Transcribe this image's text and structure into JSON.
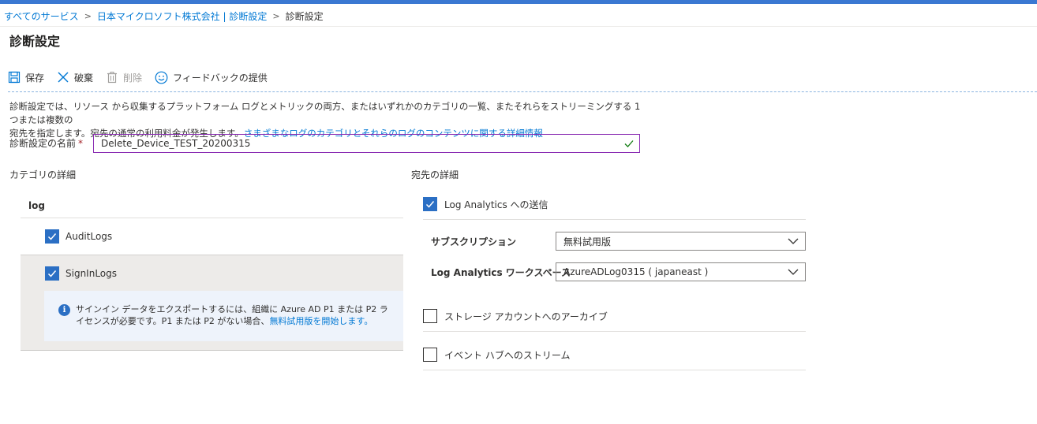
{
  "breadcrumb": {
    "items": [
      "すべてのサービス",
      "日本マイクロソフト株式会社 | 診断設定",
      "診断設定"
    ]
  },
  "page_title": "診断設定",
  "toolbar": {
    "save": "保存",
    "discard": "破棄",
    "delete": "削除",
    "feedback": "フィードバックの提供"
  },
  "description": {
    "line1": "診断設定では、リソース から収集するプラットフォーム ログとメトリックの両方、またはいずれかのカテゴリの一覧、またそれらをストリーミングする 1 つまたは複数の",
    "line2": "宛先を指定します。宛先の通常の利用料金が発生します。",
    "link": "さまざまなログのカテゴリとそれらのログのコンテンツに関する詳細情報"
  },
  "name_field": {
    "label": "診断設定の名前",
    "required_mark": "*",
    "value": "Delete_Device_TEST_20200315"
  },
  "categories": {
    "title": "カテゴリの詳細",
    "group": "log",
    "items": [
      {
        "label": "AuditLogs",
        "checked": true
      },
      {
        "label": "SignInLogs",
        "checked": true
      }
    ],
    "info": {
      "text": "サインイン データをエクスポートするには、組織に Azure AD P1 または P2 ライセンスが必要です。P1 または P2 がない場合、",
      "link": "無料試用版を開始します。"
    }
  },
  "destinations": {
    "title": "宛先の詳細",
    "log_analytics": {
      "label": "Log Analytics への送信",
      "checked": true
    },
    "subscription": {
      "label": "サブスクリプション",
      "value": "無料試用版"
    },
    "workspace": {
      "label": "Log Analytics ワークスペース",
      "value": "AzureADLog0315 ( japaneast )"
    },
    "storage": {
      "label": "ストレージ アカウントへのアーカイブ",
      "checked": false
    },
    "eventhub": {
      "label": "イベント ハブへのストリーム",
      "checked": false
    }
  },
  "colors": {
    "accent": "#0078d4",
    "checkbox": "#2b6fc4",
    "input_border": "#8a2db3",
    "top_bar": "#3a78d2"
  }
}
